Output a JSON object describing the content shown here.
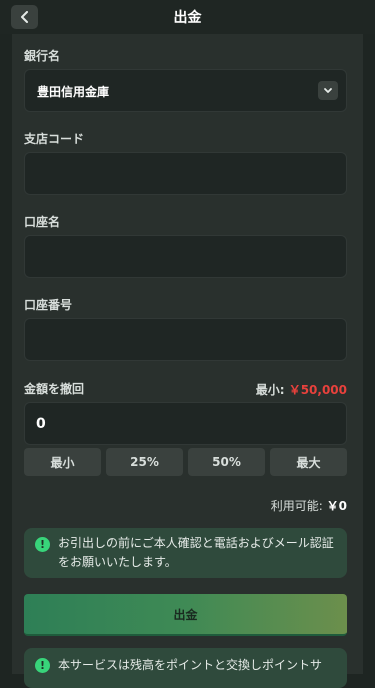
{
  "header": {
    "title": "出金"
  },
  "form": {
    "bank_label": "銀行名",
    "bank_value": "豊田信用金庫",
    "branch_label": "支店コード",
    "branch_value": "",
    "account_name_label": "口座名",
    "account_name_value": "",
    "account_number_label": "口座番号",
    "account_number_value": "",
    "amount_label": "金額を撤回",
    "min_prefix": "最小:",
    "min_amount": "￥50,000",
    "amount_value": "0",
    "quick_buttons": [
      "最小",
      "25%",
      "50%",
      "最大"
    ],
    "available_label": "利用可能:",
    "available_value": "￥0"
  },
  "notice": {
    "text": "お引出しの前にご本人確認と電話およびメール認証をお願いいたします。"
  },
  "withdraw_button": "出金",
  "notice2": {
    "text": "本サービスは残高をポイントと交換しポイントサ"
  },
  "colors": {
    "background": "#1e2522",
    "panel": "#29302d",
    "accent_green": "#38d47a",
    "min_red": "#e8413c"
  }
}
